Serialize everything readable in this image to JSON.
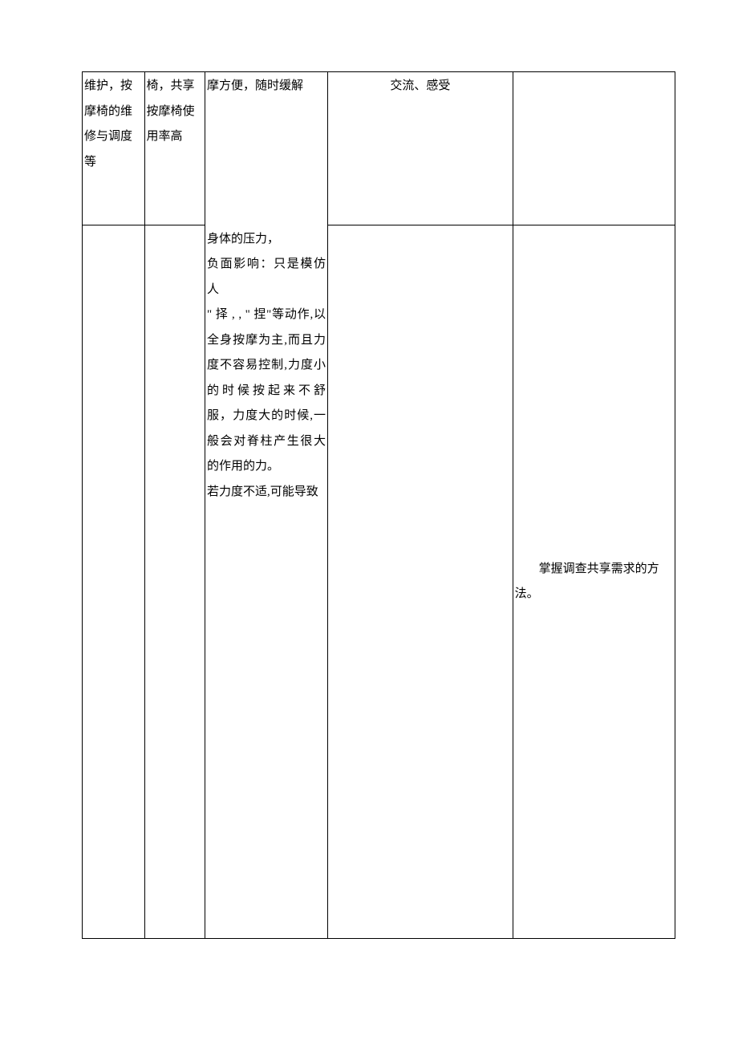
{
  "table": {
    "col1": "维护，按摩椅的维修与调度等",
    "col2": "椅，共享按摩椅使用率高",
    "col3_a": "摩方便，随时缓解",
    "col3_b": "身体的压力，\n负面影响：只是模仿人\n\" 择 , , \" 捏\"等动作,以全身按摩为主,而且力度不容易控制,力度小的时候按起来不舒服，力度大的时候,一般会对脊柱产生很大的作用的力。\n若力度不适,可能导致",
    "col4_a": "交流、感受",
    "col5_b": "        掌握调查共享需求的方法。"
  }
}
